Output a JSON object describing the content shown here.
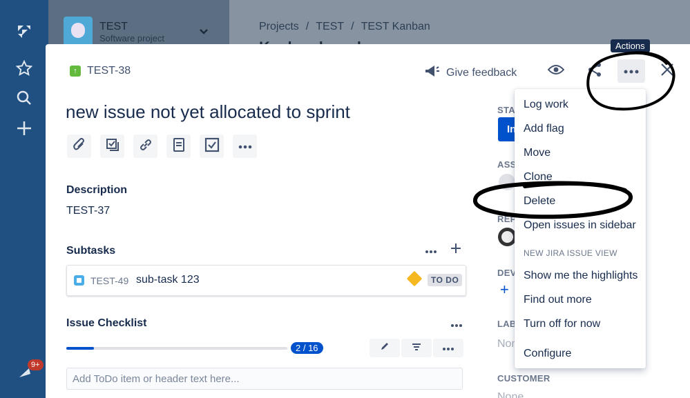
{
  "global_nav": {
    "notification_badge": "9+"
  },
  "project": {
    "name": "TEST",
    "type": "Software project"
  },
  "breadcrumbs": [
    "Projects",
    "TEST",
    "TEST Kanban"
  ],
  "board_title_peek": "Kanban board",
  "issue": {
    "key": "TEST-38",
    "summary": "new issue not yet allocated to sprint"
  },
  "header": {
    "give_feedback": "Give feedback",
    "tooltip": "Actions"
  },
  "description": {
    "title": "Description",
    "text": "TEST-37"
  },
  "subtasks": {
    "title": "Subtasks",
    "items": [
      {
        "key": "TEST-49",
        "summary": "sub-task 123",
        "status": "TO DO"
      }
    ]
  },
  "checklist": {
    "title": "Issue Checklist",
    "progress_label": "2 / 16",
    "progress_fraction": 0.125,
    "input_placeholder": "Add ToDo item or header text here..."
  },
  "sidebar_peek": {
    "status_label": "STAT",
    "status_value": "In",
    "assignee_label": "ASS",
    "reporter_label": "REP",
    "development_label": "DEV",
    "labels_label": "LAB",
    "labels_value": "Non",
    "customer_label": "CUSTOMER",
    "customer_value": "None"
  },
  "actions_menu": {
    "items": [
      "Log work",
      "Add flag",
      "Move",
      "Clone",
      "Delete",
      "Open issues in sidebar"
    ],
    "section_heading": "NEW JIRA ISSUE VIEW",
    "section_items": [
      "Show me the highlights",
      "Find out more",
      "Turn off for now"
    ],
    "footer_item": "Configure"
  },
  "colors": {
    "accent": "#0052cc",
    "nav_background": "#205081",
    "story_icon": "#63ba3c",
    "annotation_ink": "#000000"
  }
}
